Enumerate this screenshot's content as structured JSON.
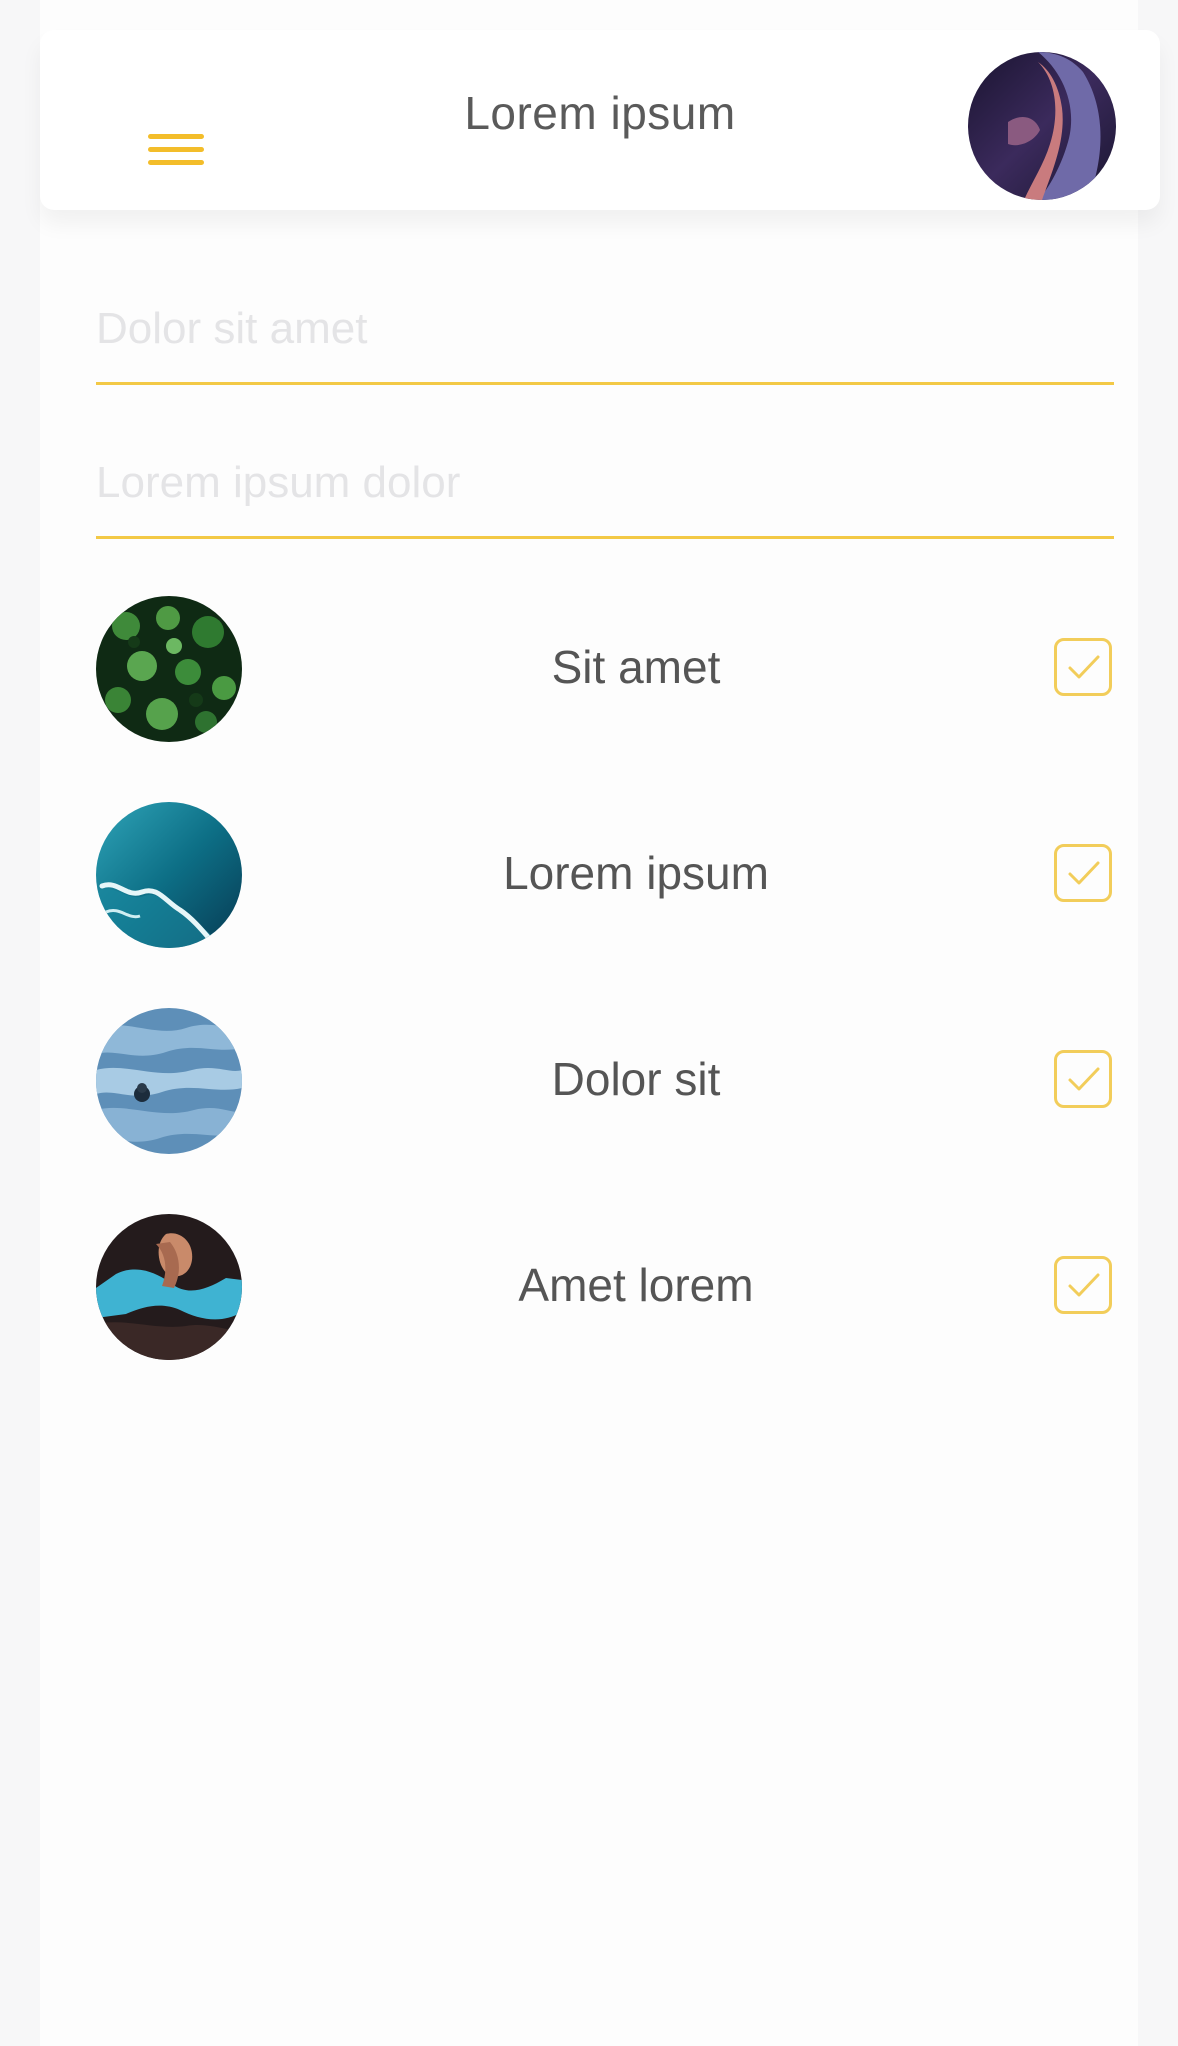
{
  "header": {
    "title": "Lorem ipsum",
    "menu_icon": "hamburger-menu-icon",
    "avatar": "profile-avatar"
  },
  "form": {
    "field1_placeholder": "Dolor sit amet",
    "field2_placeholder": "Lorem ipsum dolor"
  },
  "items": [
    {
      "label": "Sit amet",
      "checked": true,
      "thumbnail": "green-foliage"
    },
    {
      "label": "Lorem ipsum",
      "checked": true,
      "thumbnail": "ocean-aerial"
    },
    {
      "label": "Dolor sit",
      "checked": true,
      "thumbnail": "sea-waves"
    },
    {
      "label": "Amet lorem",
      "checked": true,
      "thumbnail": "person-in-water"
    }
  ],
  "colors": {
    "accent": "#f3bd2a",
    "text": "#555555",
    "placeholder": "#e4e4e6",
    "background": "#f7f7f8"
  }
}
